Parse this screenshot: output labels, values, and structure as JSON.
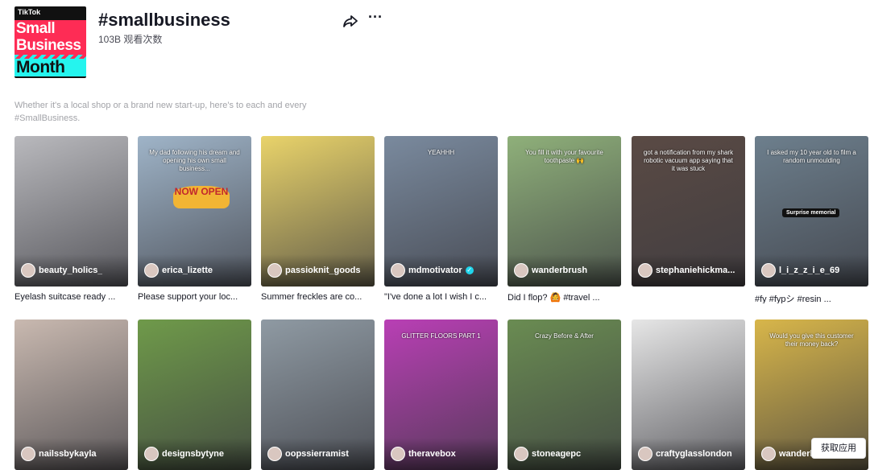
{
  "banner": {
    "brand": "TikTok",
    "line1": "Small",
    "line2": "Business",
    "line3": "Month"
  },
  "header": {
    "title": "#smallbusiness",
    "views": "103B 观看次数"
  },
  "description": "Whether it's a local shop or a brand new start-up, here's to each and every #SmallBusiness.",
  "videos": [
    {
      "author": "beauty_holics_",
      "caption": "Eyelash suitcase ready ...",
      "verified": false,
      "bg": "#b9b9bd"
    },
    {
      "author": "erica_lizette",
      "caption": "Please support your loc...",
      "overlay": "My dad following his dream and opening his own small business...",
      "sign": "NOW OPEN",
      "verified": false,
      "bg": "#9fb4c8"
    },
    {
      "author": "passioknit_goods",
      "caption": "Summer freckles are co...",
      "verified": false,
      "bg": "#e9d36a"
    },
    {
      "author": "mdmotivator",
      "caption": "\"I've done a lot I wish I c...",
      "overlay": "YEAHHH",
      "verified": true,
      "bg": "#7a8a9e"
    },
    {
      "author": "wanderbrush",
      "caption": "Did I flop? 🙆 #travel ...",
      "overlay": "You fill it with your favourite toothpaste 🙌",
      "verified": false,
      "bg": "#8fb07a"
    },
    {
      "author": "stephaniehickma...",
      "caption": "",
      "overlay": "got a notification from my shark robotic vacuum app saying that it was stuck",
      "verified": false,
      "bg": "#5a4a44"
    },
    {
      "author": "l_i_z_z_i_e_69",
      "caption": "#fy #fypシ #resin ...",
      "overlay": "I asked my 10 year old to film a random unmoulding",
      "badge": "Surprise memorial",
      "verified": false,
      "bg": "#6d7f8d"
    },
    {
      "author": "nailssbykayla",
      "caption": "",
      "verified": false,
      "bg": "#c9b9b0"
    },
    {
      "author": "designsbytyne",
      "caption": "",
      "verified": false,
      "bg": "#6f9a4a"
    },
    {
      "author": "oopssierramist",
      "caption": "",
      "verified": false,
      "bg": "#8f9aa3"
    },
    {
      "author": "theravebox",
      "caption": "",
      "overlay": "GLITTER FLOORS PART 1",
      "verified": false,
      "bg": "#b93fb5"
    },
    {
      "author": "stoneagepc",
      "caption": "",
      "overlay": "Crazy Before & After",
      "verified": false,
      "bg": "#6a8c52"
    },
    {
      "author": "craftyglasslondon",
      "caption": "",
      "verified": false,
      "bg": "#e6e6e6"
    },
    {
      "author": "wanderlustsweets",
      "caption": "",
      "overlay": "Would you give this customer their money back?",
      "verified": false,
      "bg": "#d8b64a"
    }
  ],
  "get_app": "获取应用",
  "colors": {
    "accent": "#fe2c55",
    "cyan": "#25f4ee",
    "verified": "#20d5ec"
  }
}
